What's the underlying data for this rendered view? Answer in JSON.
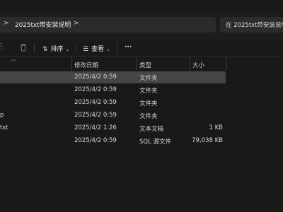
{
  "address": {
    "folder": "2025txt带安装说明",
    "separator": ">"
  },
  "search": {
    "placeholder": "在 2025txt带安装说明"
  },
  "toolbar": {
    "sort_label": "排序",
    "view_label": "查看",
    "more_label": "···"
  },
  "columns": {
    "date": "修改日期",
    "type": "类型",
    "size": "大小"
  },
  "files": [
    {
      "name": "",
      "date": "2025/4/2 0:59",
      "type": "文件夹",
      "size": ""
    },
    {
      "name": "",
      "date": "2025/4/2 0:59",
      "type": "文件夹",
      "size": ""
    },
    {
      "name": "",
      "date": "2025/4/2 0:59",
      "type": "文件夹",
      "size": ""
    },
    {
      "name": "p",
      "date": "2025/4/2 0:59",
      "type": "文件夹",
      "size": ""
    },
    {
      "name": "txt",
      "date": "2025/4/2 1:26",
      "type": "文本文档",
      "size": "1 KB"
    },
    {
      "name": "",
      "date": "2025/4/2 0:59",
      "type": "SQL 源文件",
      "size": "79,038 KB"
    }
  ]
}
